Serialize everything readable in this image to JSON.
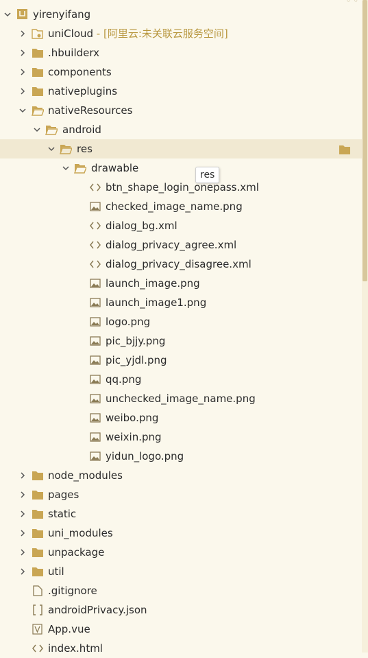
{
  "colors": {
    "background": "#fbf8ec",
    "selected_row": "#f1e9d2",
    "folder": "#c9a654",
    "scrollbar_thumb": "#d7c79c",
    "cloud_note": "#b8973f"
  },
  "tooltip": {
    "text": "res"
  },
  "tree": {
    "root": {
      "label": "yirenyifang",
      "icon": "project-icon"
    },
    "uniCloud": {
      "label": "uniCloud",
      "note": " - [阿里云:未关联云服务空间]"
    },
    "hbuilderx": {
      "label": ".hbuilderx"
    },
    "components": {
      "label": "components"
    },
    "nativeplugins": {
      "label": "nativeplugins"
    },
    "nativeResources": {
      "label": "nativeResources"
    },
    "android": {
      "label": "android"
    },
    "res": {
      "label": "res"
    },
    "drawable": {
      "label": "drawable"
    },
    "drawable_files": [
      {
        "label": "btn_shape_login_onepass.xml",
        "icon": "code-file-icon"
      },
      {
        "label": "checked_image_name.png",
        "icon": "image-file-icon"
      },
      {
        "label": "dialog_bg.xml",
        "icon": "code-file-icon"
      },
      {
        "label": "dialog_privacy_agree.xml",
        "icon": "code-file-icon"
      },
      {
        "label": "dialog_privacy_disagree.xml",
        "icon": "code-file-icon"
      },
      {
        "label": "launch_image.png",
        "icon": "image-file-icon"
      },
      {
        "label": "launch_image1.png",
        "icon": "image-file-icon"
      },
      {
        "label": "logo.png",
        "icon": "image-file-icon"
      },
      {
        "label": "pic_bjjy.png",
        "icon": "image-file-icon"
      },
      {
        "label": "pic_yjdl.png",
        "icon": "image-file-icon"
      },
      {
        "label": "qq.png",
        "icon": "image-file-icon"
      },
      {
        "label": "unchecked_image_name.png",
        "icon": "image-file-icon"
      },
      {
        "label": "weibo.png",
        "icon": "image-file-icon"
      },
      {
        "label": "weixin.png",
        "icon": "image-file-icon"
      },
      {
        "label": "yidun_logo.png",
        "icon": "image-file-icon"
      }
    ],
    "bottom_folders": [
      {
        "label": "node_modules"
      },
      {
        "label": "pages"
      },
      {
        "label": "static"
      },
      {
        "label": "uni_modules"
      },
      {
        "label": "unpackage"
      },
      {
        "label": "util"
      }
    ],
    "root_files": [
      {
        "label": ".gitignore",
        "icon": "blank-file-icon"
      },
      {
        "label": "androidPrivacy.json",
        "icon": "json-file-icon"
      },
      {
        "label": "App.vue",
        "icon": "vue-file-icon"
      },
      {
        "label": "index.html",
        "icon": "code-file-icon"
      }
    ]
  }
}
